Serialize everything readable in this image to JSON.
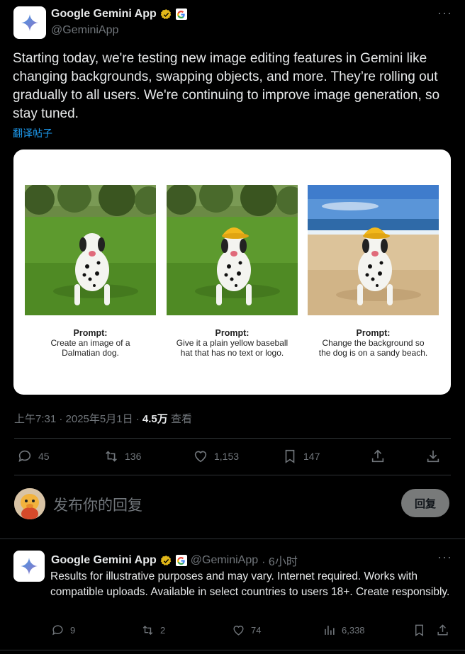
{
  "post": {
    "author_name": "Google Gemini App",
    "author_handle": "@GeminiApp",
    "text": "Starting today, we're testing new image editing features in Gemini like changing backgrounds, swapping objects, and more. They’re rolling out gradually to all users. We're continuing to improve image generation, so stay tuned.",
    "translate_label": "翻译帖子",
    "media": {
      "panels": [
        {
          "title": "Prompt:",
          "line1": "Create an image of a",
          "line2": "Dalmatian dog."
        },
        {
          "title": "Prompt:",
          "line1": "Give it a plain yellow baseball",
          "line2": "hat that has no text or logo."
        },
        {
          "title": "Prompt:",
          "line1": "Change the background so",
          "line2": "the dog is on a sandy beach."
        }
      ]
    },
    "time": "上午7:31 · 2025年5月1日 · ",
    "views_count": "4.5万",
    "views_label": " 查看",
    "actions": {
      "replies": "45",
      "reposts": "136",
      "likes": "1,153",
      "bookmarks": "147"
    }
  },
  "reply_box": {
    "placeholder": "发布你的回复",
    "button_label": "回复"
  },
  "reply": {
    "author_name": "Google Gemini App",
    "author_handle": "@GeminiApp",
    "time": "· 6小时",
    "text": "Results for illustrative purposes and may vary. Internet required. Works with compatible uploads. Available in select countries to users 18+. Create responsibly.",
    "actions": {
      "replies": "9",
      "reposts": "2",
      "likes": "74",
      "views": "6,338"
    }
  },
  "colors": {
    "background": "#000000",
    "text_primary": "#e7e9ea",
    "text_secondary": "#71767b",
    "link": "#1d9bf0",
    "verified": "#e2b719",
    "border": "#2f3336"
  }
}
